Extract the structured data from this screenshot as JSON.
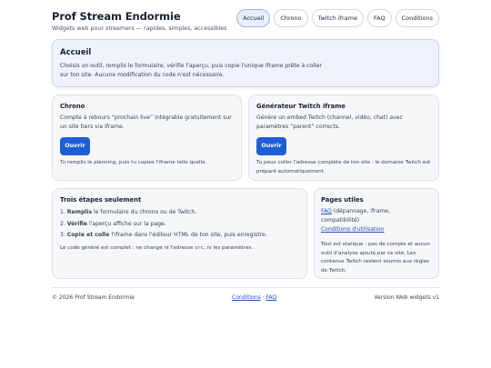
{
  "header": {
    "title": "Prof Stream Endormie",
    "subtitle": "Widgets web pour streamers — rapides, simples, accessibles"
  },
  "nav": {
    "tabs": [
      "Accueil",
      "Chrono",
      "Twitch iframe",
      "FAQ",
      "Conditions"
    ],
    "active": "Accueil"
  },
  "hero": {
    "title": "Accueil",
    "text_line1": "Choisis un outil, remplis le formulaire, vérifie l'aperçu, puis copie l'unique iframe prête à coller",
    "text_line2": "sur ton site. Aucune modification du code n'est nécessaire."
  },
  "chrono": {
    "title": "Chrono",
    "description": "Compte à rebours “prochain live” intégrable gratuitement sur un site tiers via iframe.",
    "button": "Ouvrir",
    "note": "Tu remplis le planning, puis tu copies l'iframe telle quelle."
  },
  "twitch": {
    "title": "Générateur Twitch iframe",
    "description": "Génère un embed Twitch (channel, vidéo, chat) avec paramètres “parent” corrects.",
    "button": "Ouvrir",
    "note": "Tu peux coller l'adresse complète de ton site : le domaine Twitch est préparé automatiquement."
  },
  "steps": {
    "title": "Trois étapes seulement",
    "items": [
      {
        "bold": "Remplis",
        "rest": " le formulaire du chrono ou de Twitch."
      },
      {
        "bold": "Vérifie",
        "rest": " l'aperçu affiché sur la page."
      },
      {
        "bold": "Copie et colle",
        "rest": " l'iframe dans l'éditeur HTML de ton site, puis enregistre."
      }
    ],
    "note_before": "Le code généré est complet : ne change ni l'adresse ",
    "note_code": "src",
    "note_after": ", ni les paramètres."
  },
  "pages": {
    "title": "Pages utiles",
    "faq_link": "FAQ",
    "faq_desc": " (dépannage, iframe,",
    "faq_desc2": "compatibilité)",
    "conditions_link": "Conditions d'utilisation",
    "note": "Tout est statique : pas de compte et aucun outil d'analyse ajouté par ce site. Les contenus Twitch restent soumis aux règles de Twitch."
  },
  "footer": {
    "copyright": "© 2026 Prof Stream Endormie",
    "link_conditions": "Conditions",
    "separator": " · ",
    "link_faq": "FAQ",
    "version": "Version Web widgets v1"
  },
  "colors": {
    "accent": "#1f5fd6",
    "hero_bg": "#eef3fd",
    "card_bg": "#f6f7f9",
    "active_tab_bg": "#e7eefc"
  }
}
